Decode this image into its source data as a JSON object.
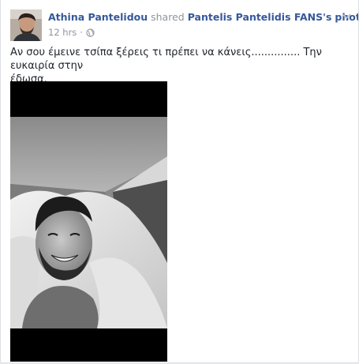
{
  "post": {
    "author_name": "Athina Pantelidou",
    "shared_word": "shared",
    "page_name": "Pantelis Pantelidis FANS",
    "page_suffix": "'s",
    "photo_word": "photo",
    "period": ".",
    "time": "12 hrs",
    "separator": "·",
    "privacy_icon": "globe-icon",
    "menu_icon": "chevron-down-icon",
    "text_line1": "Αν σου έμεινε τσίπα ξέρεις τι πρέπει να κάνεις............... Την ευκαιρία στην",
    "text_line2": "έδωσα."
  },
  "colors": {
    "link": "#365899",
    "meta": "#90949c",
    "text": "#1d2129",
    "photo_background": "#000000"
  }
}
